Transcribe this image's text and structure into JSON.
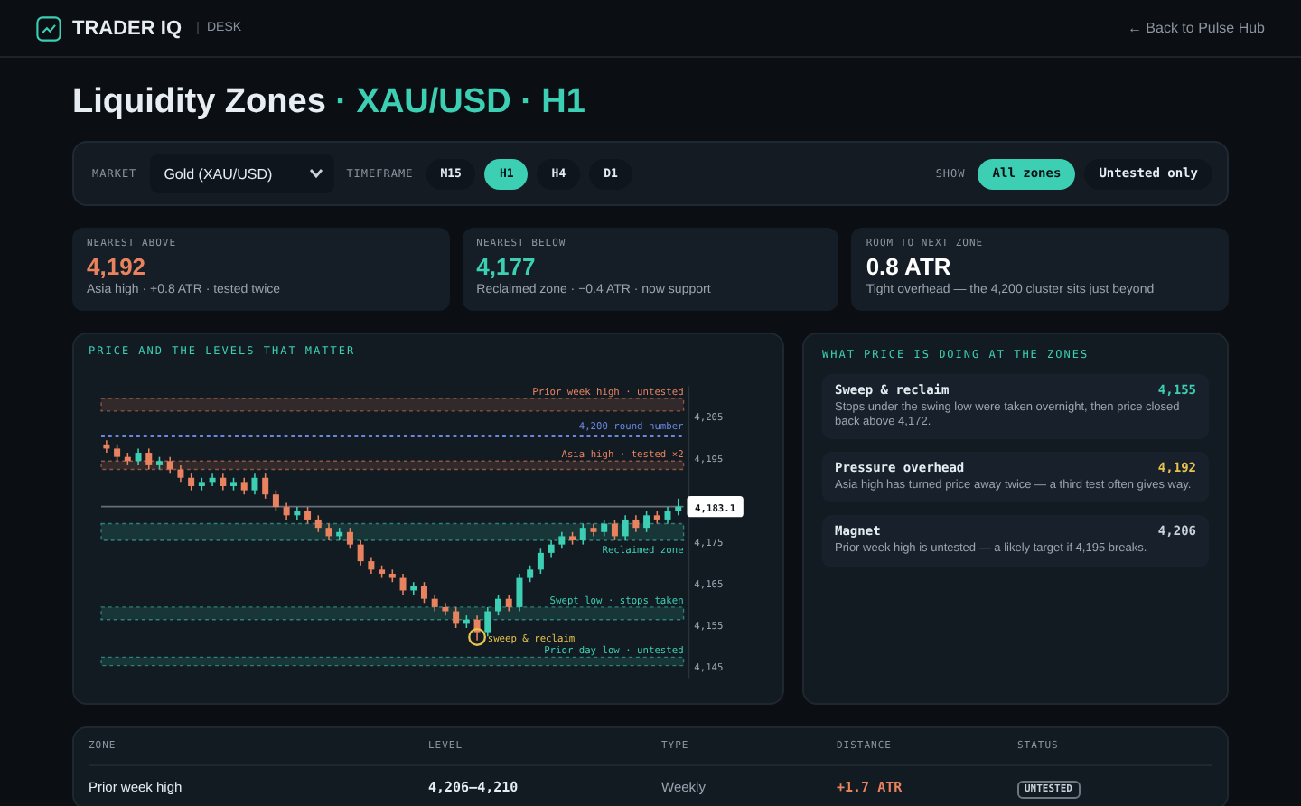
{
  "header": {
    "brand": "TRADER IQ",
    "section": "DESK",
    "back_link": "← Back to Pulse Hub"
  },
  "title": {
    "main": "Liquidity Zones",
    "accent": "· XAU/USD · H1"
  },
  "filters": {
    "market_label": "MARKET",
    "market": "Gold (XAU/USD)",
    "timeframe_label": "TIMEFRAME",
    "timeframes": [
      {
        "label": "M15",
        "selected": false
      },
      {
        "label": "H1",
        "selected": true
      },
      {
        "label": "H4",
        "selected": false
      },
      {
        "label": "D1",
        "selected": false
      }
    ],
    "show_label": "SHOW",
    "show_options": [
      {
        "label": "All zones",
        "selected": true
      },
      {
        "label": "Untested only",
        "selected": false
      }
    ]
  },
  "stats": [
    {
      "label": "NEAREST ABOVE",
      "value": "4,192",
      "color": "#e8825f",
      "note": "Asia high · +0.8 ATR · tested twice"
    },
    {
      "label": "NEAREST BELOW",
      "value": "4,177",
      "color": "#3ccfb4",
      "note": "Reclaimed zone · −0.4 ATR · now support"
    },
    {
      "label": "ROOM TO NEXT ZONE",
      "value": "0.8 ATR",
      "color": "#ffffff",
      "note": "Tight overhead — the 4,200 cluster sits just beyond"
    }
  ],
  "chart": {
    "chart_data": {
      "type": "candlestick",
      "title": "PRICE AND THE LEVELS THAT MATTER",
      "ylim": [
        4142,
        4212
      ],
      "yticks": [
        {
          "value": 4145,
          "label": "4,145"
        },
        {
          "value": 4155,
          "label": "4,155"
        },
        {
          "value": 4165,
          "label": "4,165"
        },
        {
          "value": 4175,
          "label": "4,175"
        },
        {
          "value": 4195,
          "label": "4,195"
        },
        {
          "value": 4205,
          "label": "4,205"
        }
      ],
      "ohlc": [
        [
          4198,
          4199,
          4196,
          4197
        ],
        [
          4197,
          4198,
          4194,
          4195
        ],
        [
          4195,
          4196,
          4193,
          4194
        ],
        [
          4194,
          4197,
          4193,
          4196
        ],
        [
          4196,
          4197,
          4192,
          4193
        ],
        [
          4193,
          4195,
          4192,
          4194
        ],
        [
          4194,
          4195,
          4191,
          4192
        ],
        [
          4192,
          4193,
          4189,
          4190
        ],
        [
          4190,
          4191,
          4187,
          4188
        ],
        [
          4188,
          4190,
          4187,
          4189
        ],
        [
          4189,
          4191,
          4188,
          4190
        ],
        [
          4190,
          4191,
          4187,
          4188
        ],
        [
          4188,
          4190,
          4187,
          4189
        ],
        [
          4189,
          4190,
          4186,
          4187
        ],
        [
          4187,
          4191,
          4186,
          4190
        ],
        [
          4190,
          4191,
          4185,
          4186
        ],
        [
          4186,
          4187,
          4182,
          4183
        ],
        [
          4183,
          4184,
          4180,
          4181
        ],
        [
          4181,
          4183,
          4180,
          4182
        ],
        [
          4182,
          4183,
          4179,
          4180
        ],
        [
          4180,
          4181,
          4177,
          4178
        ],
        [
          4178,
          4179,
          4175,
          4176
        ],
        [
          4176,
          4178,
          4175,
          4177
        ],
        [
          4177,
          4178,
          4173,
          4174
        ],
        [
          4174,
          4175,
          4169,
          4170
        ],
        [
          4170,
          4171,
          4167,
          4168
        ],
        [
          4168,
          4169,
          4166,
          4167
        ],
        [
          4167,
          4168,
          4165,
          4166
        ],
        [
          4166,
          4167,
          4162,
          4163
        ],
        [
          4163,
          4165,
          4162,
          4164
        ],
        [
          4164,
          4165,
          4160,
          4161
        ],
        [
          4161,
          4162,
          4158,
          4159
        ],
        [
          4159,
          4160,
          4157,
          4158
        ],
        [
          4158,
          4159,
          4154,
          4155
        ],
        [
          4155,
          4157,
          4154,
          4156
        ],
        [
          4156,
          4157,
          4151,
          4153
        ],
        [
          4153,
          4159,
          4152,
          4158
        ],
        [
          4158,
          4162,
          4157,
          4161
        ],
        [
          4161,
          4162,
          4158,
          4159
        ],
        [
          4159,
          4167,
          4158,
          4166
        ],
        [
          4166,
          4169,
          4165,
          4168
        ],
        [
          4168,
          4173,
          4167,
          4172
        ],
        [
          4172,
          4175,
          4171,
          4174
        ],
        [
          4174,
          4177,
          4173,
          4176
        ],
        [
          4176,
          4177,
          4174,
          4175
        ],
        [
          4175,
          4179,
          4174,
          4178
        ],
        [
          4178,
          4179,
          4176,
          4177
        ],
        [
          4177,
          4180,
          4176,
          4179
        ],
        [
          4179,
          4180,
          4175,
          4176
        ],
        [
          4176,
          4181,
          4175,
          4180
        ],
        [
          4180,
          4181,
          4177,
          4178
        ],
        [
          4178,
          4182,
          4177,
          4181
        ],
        [
          4181,
          4182,
          4179,
          4180
        ],
        [
          4180,
          4183,
          4179,
          4182
        ],
        [
          4182,
          4185,
          4181,
          4183.1
        ]
      ],
      "bands": [
        {
          "axis": "y",
          "from": 4206,
          "to": 4209,
          "label": "Prior week high · untested",
          "color": "#e8825f"
        },
        {
          "axis": "y",
          "from": 4192,
          "to": 4194,
          "label": "Asia high · tested ×2",
          "color": "#e8825f"
        },
        {
          "axis": "y",
          "from": 4175,
          "to": 4179,
          "label": "Reclaimed zone",
          "color": "#3ccfb4"
        },
        {
          "axis": "y",
          "from": 4156,
          "to": 4159,
          "label": "Swept low · stops taken",
          "color": "#3ccfb4"
        },
        {
          "axis": "y",
          "from": 4145,
          "to": 4147,
          "label": "Prior day low · untested",
          "color": "#3ccfb4"
        }
      ],
      "ref_lines": [
        {
          "axis": "y",
          "value": 4200,
          "label": "4,200 round number",
          "color": "#6b86e0"
        },
        {
          "axis": "y",
          "value": 4183.1,
          "label": "4,183.1",
          "color": "#8b949e"
        }
      ],
      "annotations": [
        {
          "text": "sweep & reclaim"
        }
      ]
    }
  },
  "insights": {
    "title": "WHAT PRICE IS DOING AT THE ZONES",
    "items": [
      {
        "title": "Sweep & reclaim",
        "value": "4,155",
        "color": "#3ccfb4",
        "text": "Stops under the swing low were taken overnight, then price closed back above 4,172."
      },
      {
        "title": "Pressure overhead",
        "value": "4,192",
        "color": "#e6c34f",
        "text": "Asia high has turned price away twice — a third test often gives way."
      },
      {
        "title": "Magnet",
        "value": "4,206",
        "color": "#c9d1d9",
        "text": "Prior week high is untested — a likely target if 4,195 breaks."
      }
    ]
  },
  "table": {
    "columns": [
      "ZONE",
      "LEVEL",
      "TYPE",
      "DISTANCE",
      "STATUS"
    ],
    "rows": [
      {
        "zone": "Prior week high",
        "level": "4,206–4,210",
        "type": "Weekly",
        "distance": "+1.7 ATR",
        "status": "UNTESTED"
      }
    ]
  }
}
